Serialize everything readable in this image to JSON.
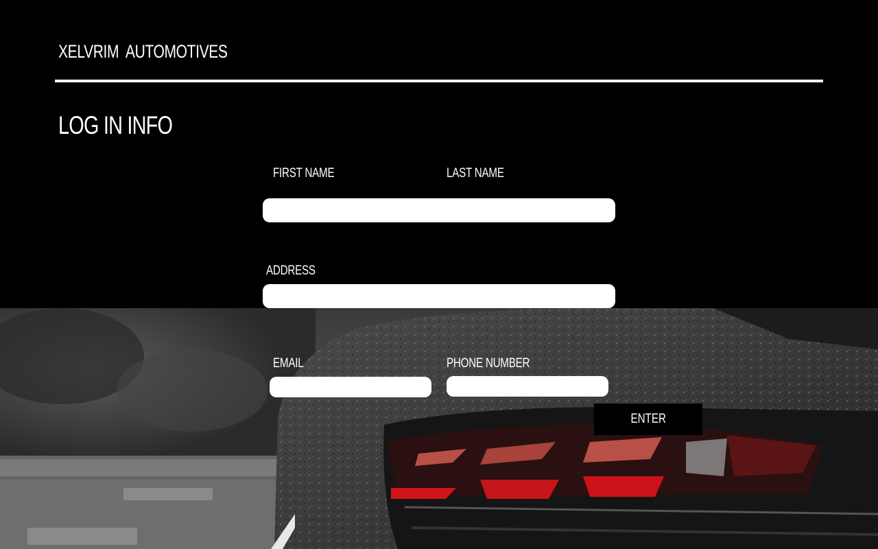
{
  "header": {
    "brand": "XELVRIM  AUTOMOTIVES"
  },
  "form": {
    "title": "LOG IN INFO",
    "first_name_label": "FIRST NAME",
    "last_name_label": "LAST NAME",
    "address_label": "ADDRESS",
    "email_label": "EMAIL",
    "phone_label": "PHONE NUMBER",
    "first_name_value": "",
    "address_value": "",
    "email_value": "",
    "phone_value": "",
    "submit_label": "ENTER"
  },
  "colors": {
    "background": "#000000",
    "text": "#ffffff",
    "field": "#ffffff",
    "taillight": "#d0141a"
  },
  "background_image": {
    "icon": "car-rear-photo"
  }
}
